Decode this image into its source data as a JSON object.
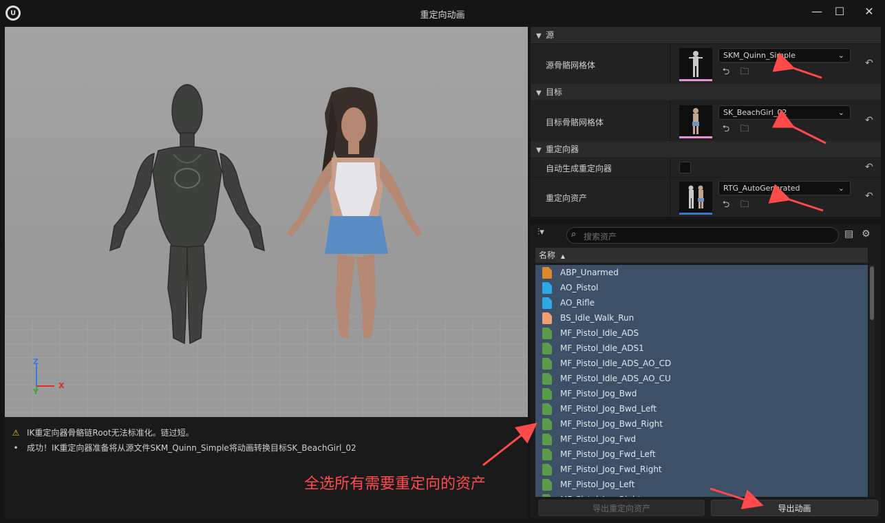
{
  "window": {
    "title": "重定向动画",
    "logo_text": "U",
    "minimize_glyph": "—",
    "maximize_glyph": "☐",
    "close_glyph": "✕"
  },
  "viewport": {
    "axis_z": "Z",
    "axis_y": "Y",
    "axis_x": "X"
  },
  "log": {
    "warning": "IK重定向器骨骼链Root无法标准化。链过短。",
    "success": "成功！IK重定向器准备将从源文件SKM_Quinn_Simple将动画转换目标SK_BeachGirl_02"
  },
  "annotation": {
    "text": "全选所有需要重定向的资产",
    "color": "#ff4a4a"
  },
  "details": {
    "source": {
      "category": "源",
      "label": "源骨骼网格体",
      "value": "SKM_Quinn_Simple"
    },
    "target": {
      "category": "目标",
      "label": "目标骨骼网格体",
      "value": "SK_BeachGirl_02"
    },
    "retargeter": {
      "category": "重定向器",
      "auto_label": "自动生成重定向器",
      "asset_label": "重定向资产",
      "value": "RTG_AutoGenerated"
    }
  },
  "browser": {
    "search_placeholder": "搜索资产",
    "column_name": "名称",
    "sort_glyph": "▲",
    "assets": [
      {
        "name": "ABP_Unarmed",
        "icon": "anim-blueprint-icon",
        "color": "#d98a2b"
      },
      {
        "name": "AO_Pistol",
        "icon": "aim-offset-icon",
        "color": "#2fa8e8"
      },
      {
        "name": "AO_Rifle",
        "icon": "aim-offset-icon",
        "color": "#2fa8e8"
      },
      {
        "name": "BS_Idle_Walk_Run",
        "icon": "blendspace-icon",
        "color": "#f0a070"
      },
      {
        "name": "MF_Pistol_Idle_ADS",
        "icon": "animation-sequence-icon",
        "color": "#5a9c4a"
      },
      {
        "name": "MF_Pistol_Idle_ADS1",
        "icon": "animation-sequence-icon",
        "color": "#5a9c4a"
      },
      {
        "name": "MF_Pistol_Idle_ADS_AO_CD",
        "icon": "animation-sequence-icon",
        "color": "#5a9c4a"
      },
      {
        "name": "MF_Pistol_Idle_ADS_AO_CU",
        "icon": "animation-sequence-icon",
        "color": "#5a9c4a"
      },
      {
        "name": "MF_Pistol_Jog_Bwd",
        "icon": "animation-sequence-icon",
        "color": "#5a9c4a"
      },
      {
        "name": "MF_Pistol_Jog_Bwd_Left",
        "icon": "animation-sequence-icon",
        "color": "#5a9c4a"
      },
      {
        "name": "MF_Pistol_Jog_Bwd_Right",
        "icon": "animation-sequence-icon",
        "color": "#5a9c4a"
      },
      {
        "name": "MF_Pistol_Jog_Fwd",
        "icon": "animation-sequence-icon",
        "color": "#5a9c4a"
      },
      {
        "name": "MF_Pistol_Jog_Fwd_Left",
        "icon": "animation-sequence-icon",
        "color": "#5a9c4a"
      },
      {
        "name": "MF_Pistol_Jog_Fwd_Right",
        "icon": "animation-sequence-icon",
        "color": "#5a9c4a"
      },
      {
        "name": "MF_Pistol_Jog_Left",
        "icon": "animation-sequence-icon",
        "color": "#5a9c4a"
      },
      {
        "name": "MF_Pistol_Jog_Right",
        "icon": "animation-sequence-icon",
        "color": "#5a9c4a"
      }
    ],
    "export_retarget_assets": "导出重定向资产",
    "export_animations": "导出动画"
  }
}
